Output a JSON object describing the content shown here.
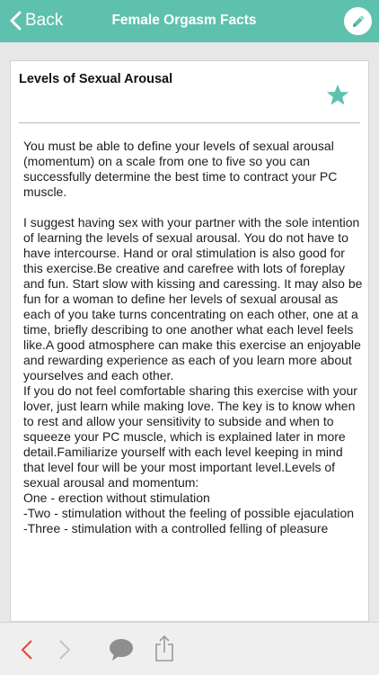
{
  "nav": {
    "back_label": "Back",
    "title": "Female Orgasm Facts",
    "edit_icon": "pencil-icon"
  },
  "article": {
    "title": "Levels of Sexual Arousal",
    "favorite_icon": "star-icon",
    "paragraphs": [
      "You must be able to define your levels of sexual arousal (momentum) on a scale from one to five so you can successfully determine the best time to contract your PC muscle.",
      "",
      "I suggest having sex with your partner with the sole intention of learning the levels of sexual arousal. You do not have to have intercourse. Hand or oral stimulation is also good for this exercise.Be creative and carefree with lots of foreplay and fun. Start slow with kissing and caressing. It may also be fun for a woman to define her levels of sexual arousal as each of you take turns concentrating on each other, one at a time, briefly describing to one another what each level feels like.A good atmosphere can make this exercise an enjoyable and rewarding experience as each of you learn more about yourselves and each other.",
      "If you do not feel comfortable sharing this exercise with your lover, just learn while making love. The key is to know when to rest and allow your sensitivity to subside and when to squeeze your PC muscle, which is explained later in more detail.Familiarize yourself with each level keeping in mind that level four will be your most important level.Levels of sexual arousal and momentum:",
      "One - erection without stimulation",
      "-Two - stimulation without the feeling of possible ejaculation",
      "-Three - stimulation with a controlled felling of pleasure"
    ]
  },
  "toolbar": {
    "prev_icon": "chevron-left-icon",
    "next_icon": "chevron-right-icon",
    "comment_icon": "speech-bubble-icon",
    "share_icon": "share-icon"
  },
  "colors": {
    "accent": "#5ec1ae",
    "prev_active": "#e0473a",
    "disabled": "#c4c4c4",
    "toolbar_icon": "#9a9a9a"
  }
}
